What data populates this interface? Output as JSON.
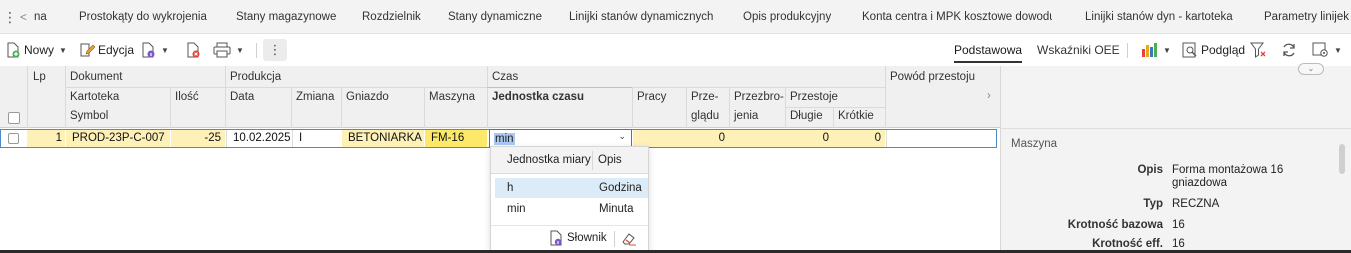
{
  "tabs": {
    "items": [
      {
        "label": "na"
      },
      {
        "label": "Prostokąty do wykrojenia"
      },
      {
        "label": "Stany magazynowe"
      },
      {
        "label": "Rozdzielnik"
      },
      {
        "label": "Stany dynamiczne"
      },
      {
        "label": "Linijki stanów dynamicznych"
      },
      {
        "label": "Opis produkcyjny"
      },
      {
        "label": "Konta centra i MPK kosztowe dowodu"
      },
      {
        "label": "Linijki stanów dyn - kartoteka"
      },
      {
        "label": "Parametry linijek"
      }
    ]
  },
  "toolbar": {
    "new_label": "Nowy",
    "edit_label": "Edycja",
    "view_tabs": [
      "Podstawowa",
      "Wskaźniki OEE"
    ],
    "preview_label": "Podgląd"
  },
  "grid": {
    "headers": {
      "lp": "Lp",
      "dokument": "Dokument",
      "kartoteka": "Kartoteka",
      "symbol": "Symbol",
      "produkcja": "Produkcja",
      "ilosc": "Ilość",
      "data": "Data",
      "zmiana": "Zmiana",
      "gniazdo": "Gniazdo",
      "maszyna": "Maszyna",
      "czas": "Czas",
      "jednostka": "Jednostka czasu",
      "pracy": "Pracy",
      "przegladu_1": "Prze-",
      "przegladu_2": "glądu",
      "przezbrojenia_1": "Przezbro-",
      "przezbrojenia_2": "jenia",
      "przestoje": "Przestoje",
      "dlugie": "Długie",
      "krotkie": "Krótkie",
      "powod": "Powód przestoju"
    },
    "row": {
      "lp": "1",
      "symbol": "PROD-23P-C-007",
      "ilosc": "-25",
      "data": "10.02.2025",
      "zmiana": "I",
      "gniazdo": "BETONIARKA",
      "maszyna": "FM-16",
      "jednostka": "min",
      "pracy": "",
      "przegladu": "0",
      "przezbrojenia": "",
      "dlugie": "0",
      "krotkie": "0"
    }
  },
  "dropdown": {
    "col_unit": "Jednostka miary",
    "col_desc": "Opis",
    "options": [
      {
        "unit": "h",
        "desc": "Godzina"
      },
      {
        "unit": "min",
        "desc": "Minuta"
      }
    ],
    "dictionary_label": "Słownik"
  },
  "details": {
    "section": "Maszyna",
    "fields": [
      {
        "label": "Opis",
        "value": "Forma montażowa 16 gniazdowa"
      },
      {
        "label": "Typ",
        "value": "RECZNA"
      },
      {
        "label": "Krotność bazowa",
        "value": "16"
      },
      {
        "label": "Krotność eff.",
        "value": "16"
      }
    ]
  },
  "colors": {
    "accent": "#3a78c3",
    "row_highlight": "#fdf1b8",
    "machine_highlight": "#fce96a",
    "option_highlight": "#dcebf8"
  }
}
